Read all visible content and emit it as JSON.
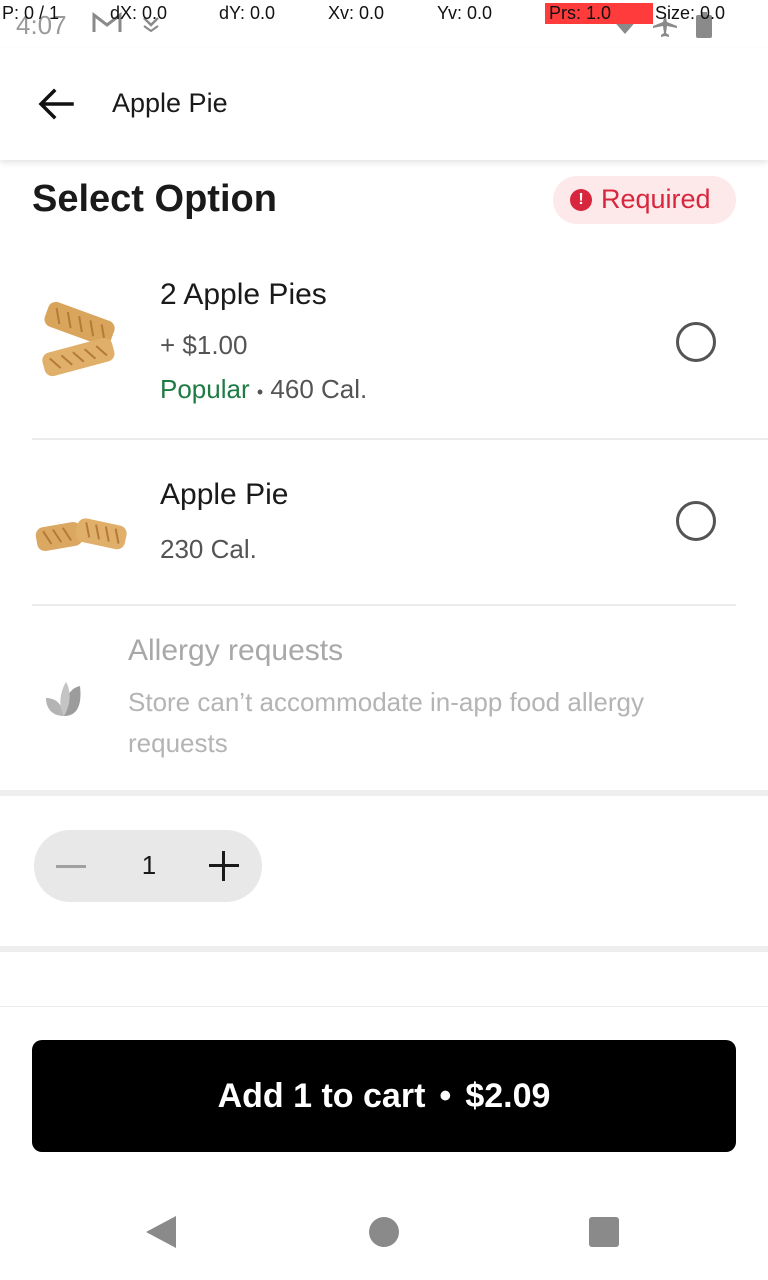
{
  "status_bar": {
    "time": "4:07",
    "debug": {
      "p": "P: 0 / 1",
      "dx": "dX: 0.0",
      "dy": "dY: 0.0",
      "xv": "Xv: 0.0",
      "yv": "Yv: 0.0",
      "prs": "Prs: 1.0",
      "size": "Size: 0.0"
    },
    "icons": [
      "gmail-icon",
      "download-icon",
      "wifi-icon",
      "airplane-icon",
      "battery-icon"
    ]
  },
  "header": {
    "title": "Apple Pie",
    "back_icon": "arrow-left-icon"
  },
  "section": {
    "title": "Select Option",
    "badge": "Required",
    "badge_icon": "!",
    "badge_color": "#d7263d"
  },
  "options": [
    {
      "name": "2 Apple Pies",
      "price": "+ $1.00",
      "popular": "Popular",
      "bullet": "•",
      "calories": "460 Cal."
    },
    {
      "name": "Apple Pie",
      "calories": "230 Cal."
    }
  ],
  "allergy": {
    "title": "Allergy requests",
    "description": "Store can’t accommodate in-app food allergy requests"
  },
  "quantity": {
    "value": "1"
  },
  "cart": {
    "label": "Add 1 to cart",
    "separator": "•",
    "price": "$2.09"
  },
  "colors": {
    "popular": "#1f7a43",
    "required": "#d7263d",
    "cart_bg": "#000000"
  }
}
